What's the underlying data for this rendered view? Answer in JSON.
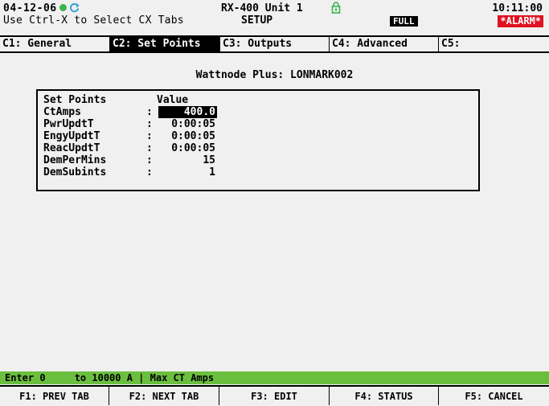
{
  "header": {
    "date": "04-12-06",
    "instruction": "Use Ctrl-X to Select CX Tabs",
    "device_name": "RX-400 Unit 1",
    "mode": "SETUP",
    "access_level": "FULL",
    "time": "10:11:00",
    "alarm": "*ALARM*",
    "colors": {
      "status_dot": "#3ab54a",
      "alarm_bg": "#e01020",
      "sync_icon": "#2a9fd6"
    }
  },
  "tabs": [
    {
      "label": "C1: General",
      "active": false
    },
    {
      "label": "C2: Set Points",
      "active": true
    },
    {
      "label": "C3: Outputs",
      "active": false
    },
    {
      "label": "C4: Advanced",
      "active": false
    },
    {
      "label": "C5:",
      "active": false
    }
  ],
  "main": {
    "device_title": "Wattnode Plus: LONMARK002",
    "table": {
      "col_name": "Set Points",
      "col_value": "Value",
      "rows": [
        {
          "name": "CtAmps",
          "sep": ":",
          "value": "400.0",
          "selected": true
        },
        {
          "name": "PwrUpdtT",
          "sep": ":",
          "value": "0:00:05",
          "selected": false
        },
        {
          "name": "EngyUpdtT",
          "sep": ":",
          "value": "0:00:05",
          "selected": false
        },
        {
          "name": "ReacUpdtT",
          "sep": ":",
          "value": "0:00:05",
          "selected": false
        },
        {
          "name": "DemPerMins",
          "sep": ":",
          "value": "15",
          "selected": false
        },
        {
          "name": "DemSubints",
          "sep": ":",
          "value": "1",
          "selected": false
        }
      ]
    }
  },
  "hint": {
    "text": "Enter 0     to 10000 A | Max CT Amps",
    "color": "#6bbf3f"
  },
  "fkeys": [
    "F1: PREV TAB",
    "F2: NEXT TAB",
    "F3: EDIT",
    "F4: STATUS",
    "F5: CANCEL"
  ]
}
